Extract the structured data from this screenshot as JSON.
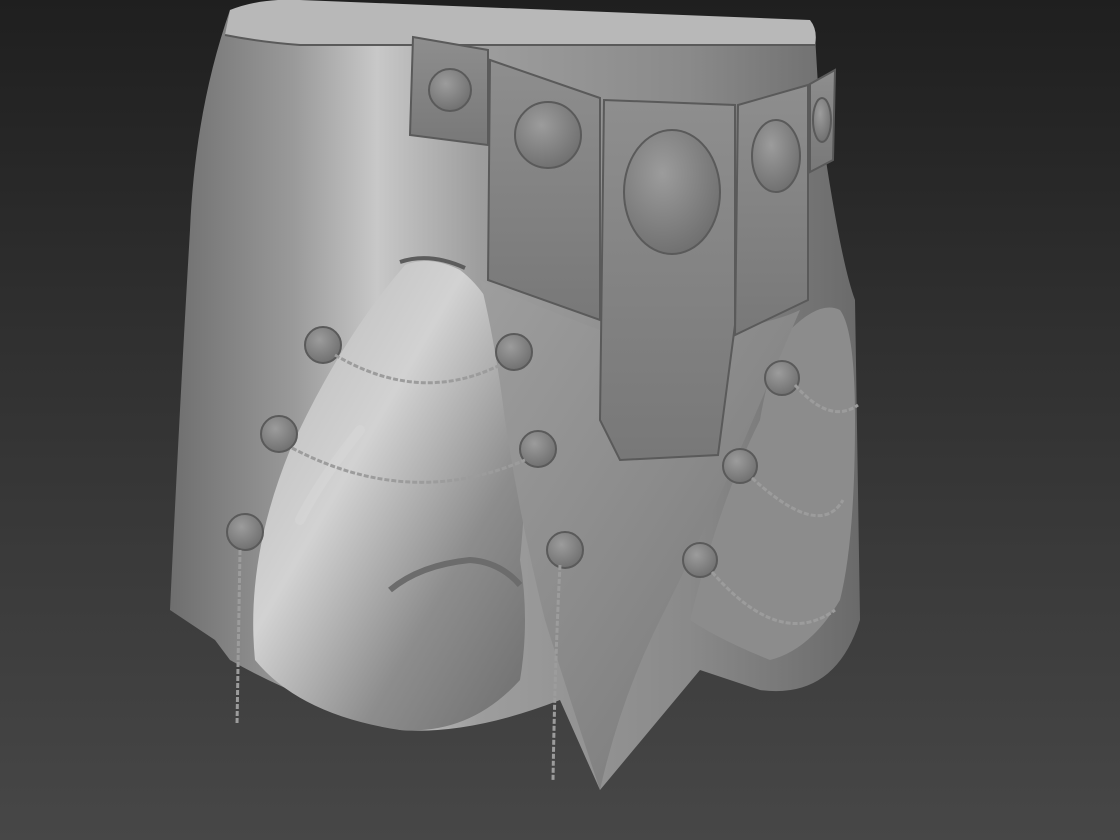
{
  "scene": {
    "subject": "sculpted-armored-skirt",
    "background_top_color": "#1f1f1f",
    "background_bottom_color": "#474747",
    "clay_color": "#9a9a9a",
    "chain_color": "#8c8c8c"
  }
}
